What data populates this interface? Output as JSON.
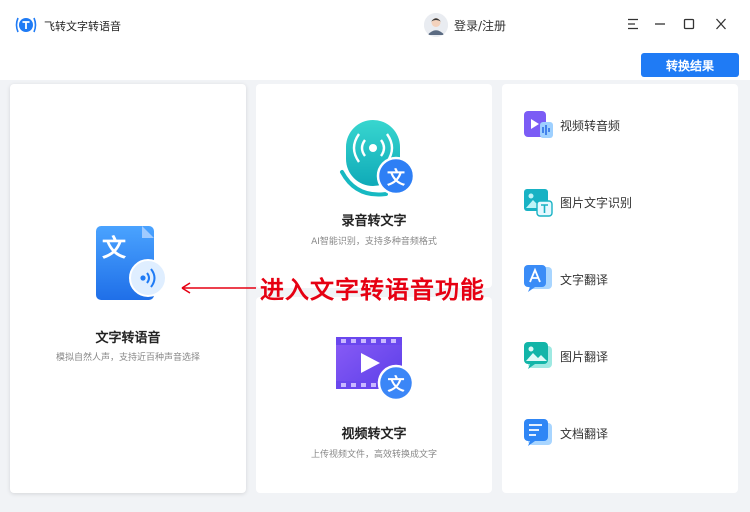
{
  "app": {
    "title": "飞转文字转语音"
  },
  "user": {
    "login_label": "登录/注册"
  },
  "toolbar": {
    "result_button": "转换结果"
  },
  "cards": {
    "tts": {
      "title": "文字转语音",
      "desc": "模拟自然人声，支持近百种声音选择",
      "badge": "文"
    },
    "recording": {
      "title": "录音转文字",
      "desc": "AI智能识别，支持多种音频格式",
      "badge": "文"
    },
    "video": {
      "title": "视频转文字",
      "desc": "上传视频文件，高效转换成文字",
      "badge": "文"
    }
  },
  "side_items": [
    {
      "label": "视频转音频",
      "icon": "video-audio-icon"
    },
    {
      "label": "图片文字识别",
      "icon": "image-ocr-icon"
    },
    {
      "label": "文字翻译",
      "icon": "text-translate-icon"
    },
    {
      "label": "图片翻译",
      "icon": "image-translate-icon"
    },
    {
      "label": "文档翻译",
      "icon": "document-translate-icon"
    }
  ],
  "annotation": {
    "text": "进入文字转语音功能"
  },
  "colors": {
    "accent": "#1f7bf5",
    "annotation": "#e60012",
    "background": "#f1f3f6"
  }
}
